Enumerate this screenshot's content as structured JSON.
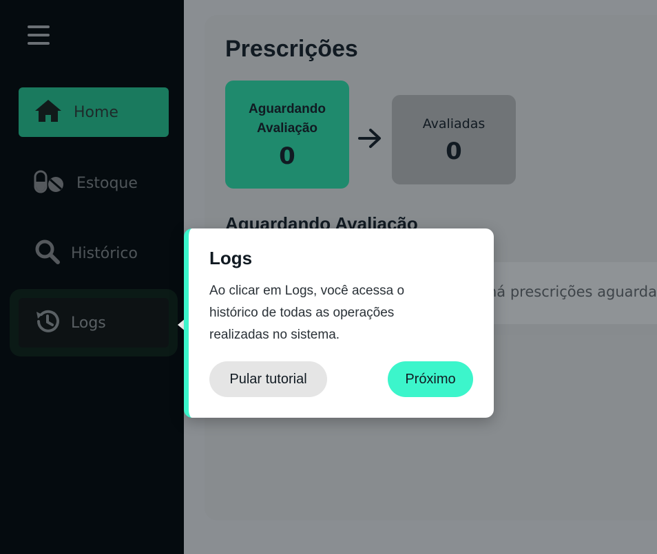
{
  "sidebar": {
    "items": [
      {
        "label": "Home",
        "icon": "home-icon",
        "active": true
      },
      {
        "label": "Estoque",
        "icon": "pills-icon"
      },
      {
        "label": "Histórico",
        "icon": "search-icon"
      },
      {
        "label": "Logs",
        "icon": "history-icon",
        "highlighted": true
      }
    ]
  },
  "main": {
    "title": "Prescrições",
    "stats": {
      "awaiting_label_1": "Aguardando",
      "awaiting_label_2": "Avaliação",
      "awaiting_value": "0",
      "evaluated_label": "Avaliadas",
      "evaluated_value": "0"
    },
    "section_title": "Aguardando Avaliação",
    "empty_text": "há prescrições aguarda"
  },
  "tutorial": {
    "title": "Logs",
    "body": "Ao clicar em Logs, você acessa o histórico de todas as operações realizadas no sistema.",
    "skip_label": "Pular tutorial",
    "next_label": "Próximo"
  },
  "colors": {
    "accent": "#3cf5cb",
    "sidebar_bg": "#050b0f",
    "active_nav": "#1a7a5e"
  }
}
